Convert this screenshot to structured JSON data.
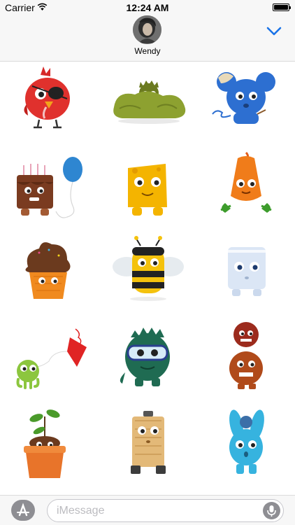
{
  "status_bar": {
    "carrier": "Carrier",
    "time": "12:24 AM"
  },
  "header": {
    "contact_name": "Wendy",
    "avatar_icon": "contact-photo",
    "expand_icon": "chevron-down-icon",
    "accent_color": "#1a73e8"
  },
  "stickers": [
    {
      "name": "red-pirate-bird-sticker"
    },
    {
      "name": "monster-in-bush-sticker"
    },
    {
      "name": "blue-mouse-sticker"
    },
    {
      "name": "cake-monster-balloon-sticker"
    },
    {
      "name": "cheese-monster-sticker"
    },
    {
      "name": "carrot-monster-sticker"
    },
    {
      "name": "ice-cream-monster-sticker"
    },
    {
      "name": "bee-monster-sticker"
    },
    {
      "name": "ice-cube-monster-sticker"
    },
    {
      "name": "green-monster-kite-sticker"
    },
    {
      "name": "diver-dinosaur-sticker"
    },
    {
      "name": "stacked-furry-monsters-sticker"
    },
    {
      "name": "plant-pot-monster-sticker"
    },
    {
      "name": "wooden-robot-sticker"
    },
    {
      "name": "blue-bunny-sticker"
    }
  ],
  "compose": {
    "placeholder": "iMessage",
    "apps_icon": "app-store-icon",
    "mic_icon": "microphone-icon"
  }
}
